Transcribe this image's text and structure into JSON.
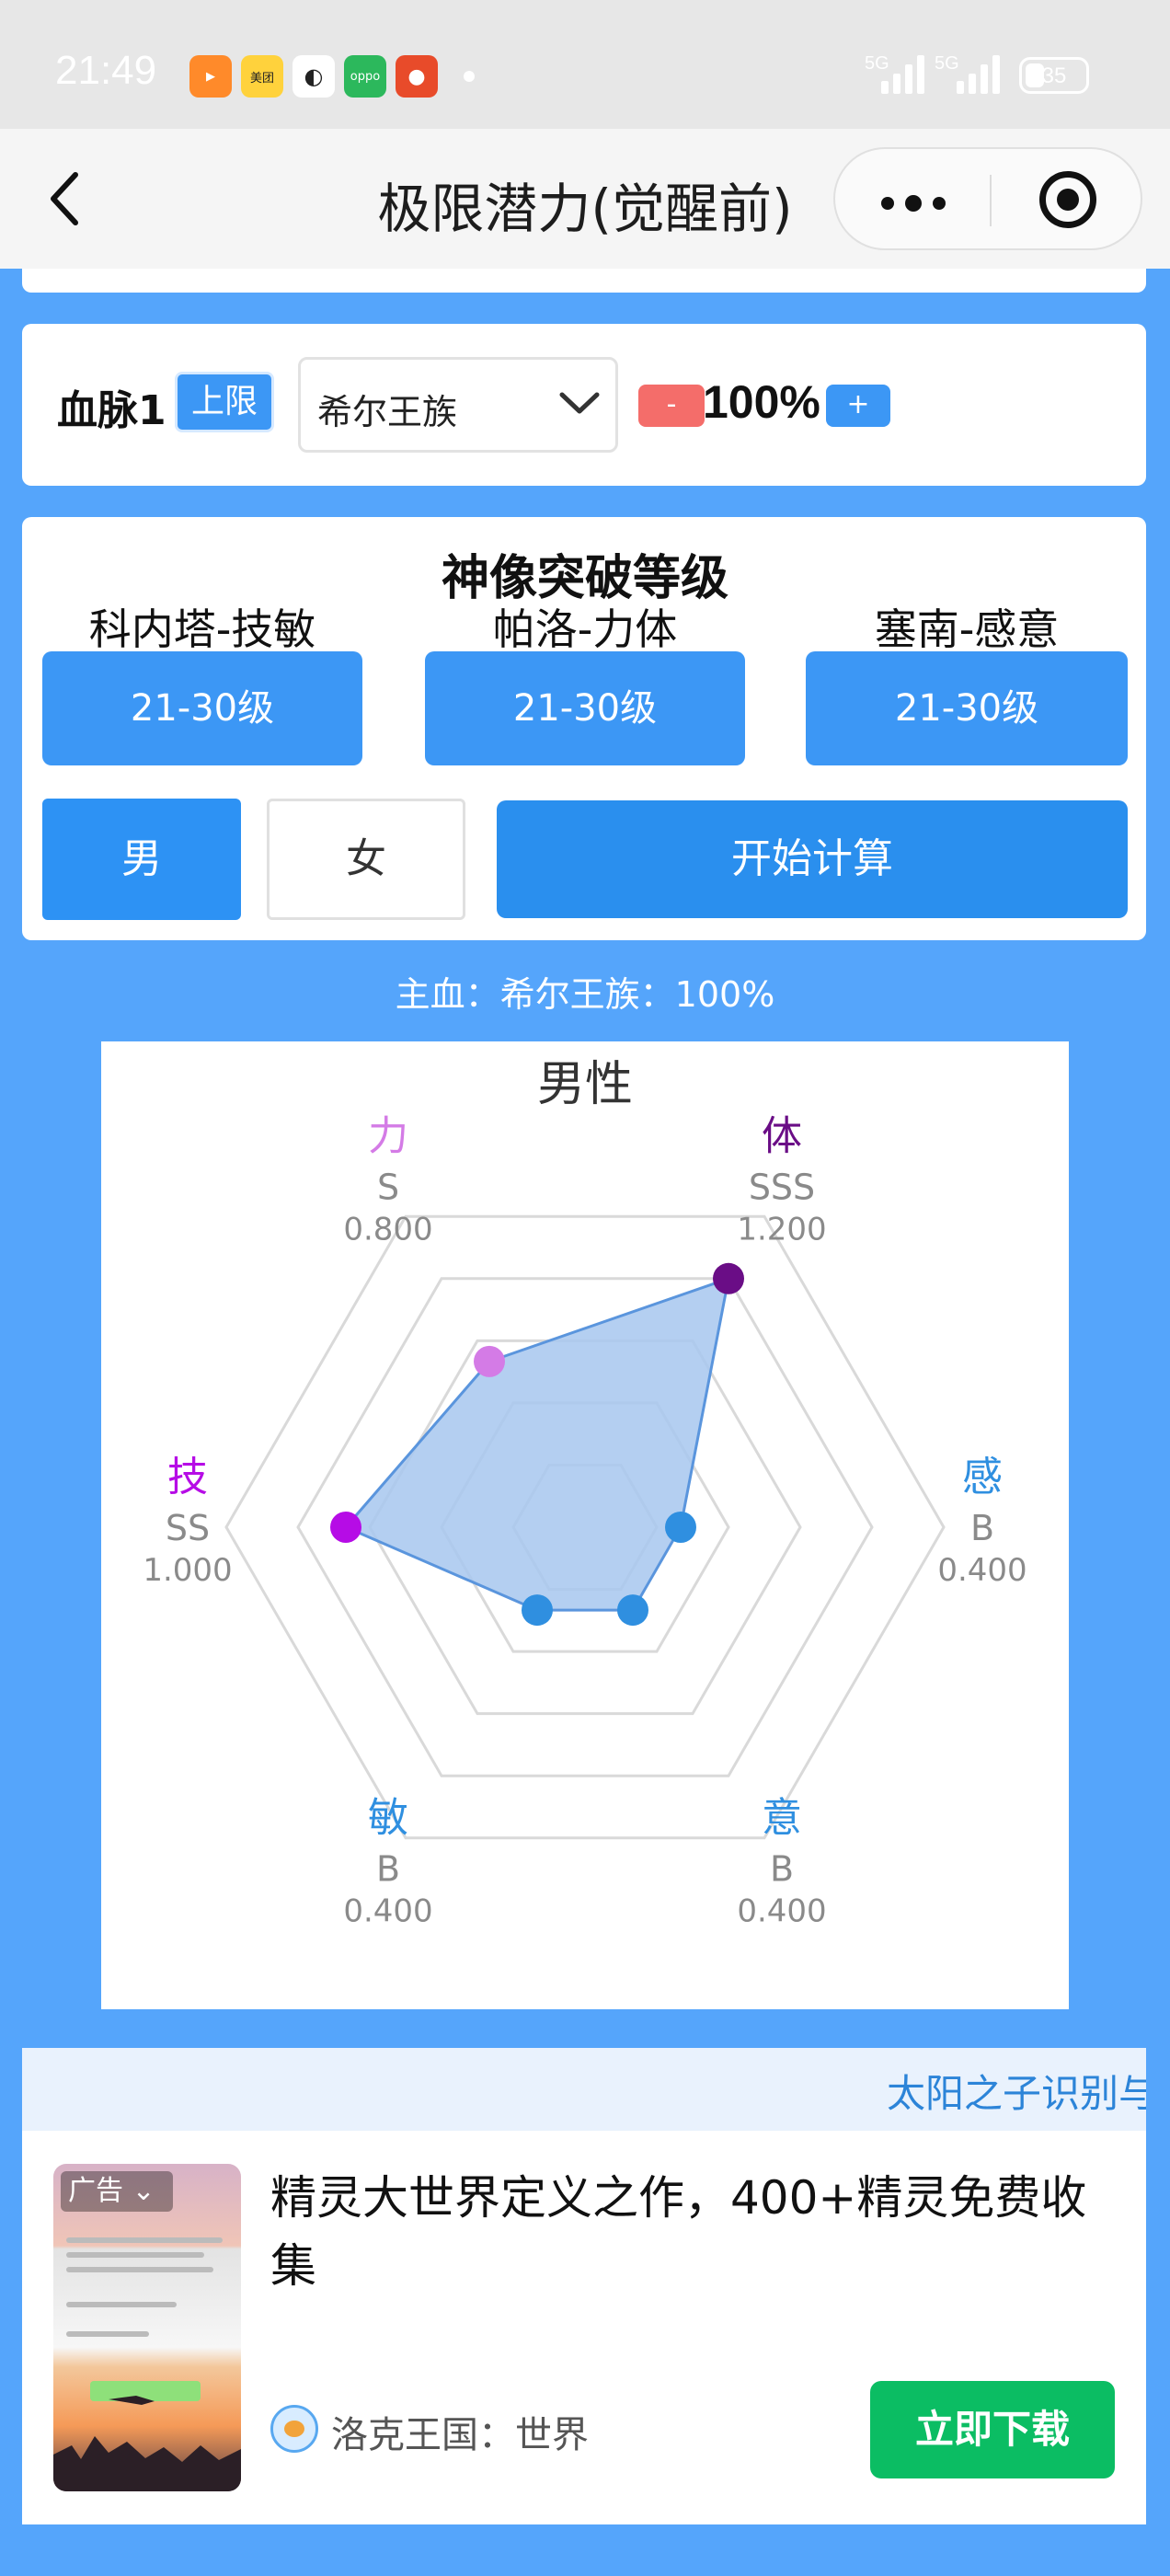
{
  "status": {
    "time": "21:49",
    "apps": [
      {
        "name": "video-app",
        "label": "",
        "color": "#ff8a2a"
      },
      {
        "name": "meituan-app",
        "label": "美团",
        "color": "#ffd23c"
      },
      {
        "name": "app-3",
        "label": "",
        "color": "#ffffff"
      },
      {
        "name": "oppo-app",
        "label": "oppo",
        "color": "#2cb85c"
      },
      {
        "name": "tomato-app",
        "label": "",
        "color": "#e84b2a"
      }
    ],
    "signal1": "5G",
    "signal2": "5G",
    "battery": "35"
  },
  "nav": {
    "title": "极限潜力(觉醒前)"
  },
  "bloodline": {
    "label": "血脉1",
    "limit_badge": "上限",
    "selected": "希尔王族",
    "minus": "-",
    "percent": "100%",
    "plus": "+"
  },
  "statue": {
    "title": "神像突破等级",
    "items": [
      {
        "name": "科内塔-技敏",
        "level": "21-30级"
      },
      {
        "name": "帕洛-力体",
        "level": "21-30级"
      },
      {
        "name": "塞南-感意",
        "level": "21-30级"
      }
    ]
  },
  "gender": {
    "male": "男",
    "female": "女",
    "selected": "male"
  },
  "calc_button": "开始计算",
  "main_blood": "主血：希尔王族：100%",
  "chart_data": {
    "type": "radar",
    "title": "男性",
    "max": 1.5,
    "rings": 5,
    "axes": [
      {
        "label": "体",
        "grade": "SSS",
        "value_text": "1.200",
        "value": 1.2,
        "color": "#6a0d86"
      },
      {
        "label": "感",
        "grade": "B",
        "value_text": "0.400",
        "value": 0.4,
        "color": "#2f8fe0"
      },
      {
        "label": "意",
        "grade": "B",
        "value_text": "0.400",
        "value": 0.4,
        "color": "#2f8fe0"
      },
      {
        "label": "敏",
        "grade": "B",
        "value_text": "0.400",
        "value": 0.4,
        "color": "#2f8fe0"
      },
      {
        "label": "技",
        "grade": "SS",
        "value_text": "1.000",
        "value": 1.0,
        "color": "#b60ce6"
      },
      {
        "label": "力",
        "grade": "S",
        "value_text": "0.800",
        "value": 0.8,
        "color": "#d47be6"
      }
    ],
    "fill_color": "#a7c7ef",
    "line_color": "#5a95dd"
  },
  "ad": {
    "marquee": "太阳之子识别与",
    "badge": "广告",
    "title": "精灵大世界定义之作，400+精灵免费收集",
    "brand": "洛克王国：世界",
    "cta": "立即下载"
  }
}
